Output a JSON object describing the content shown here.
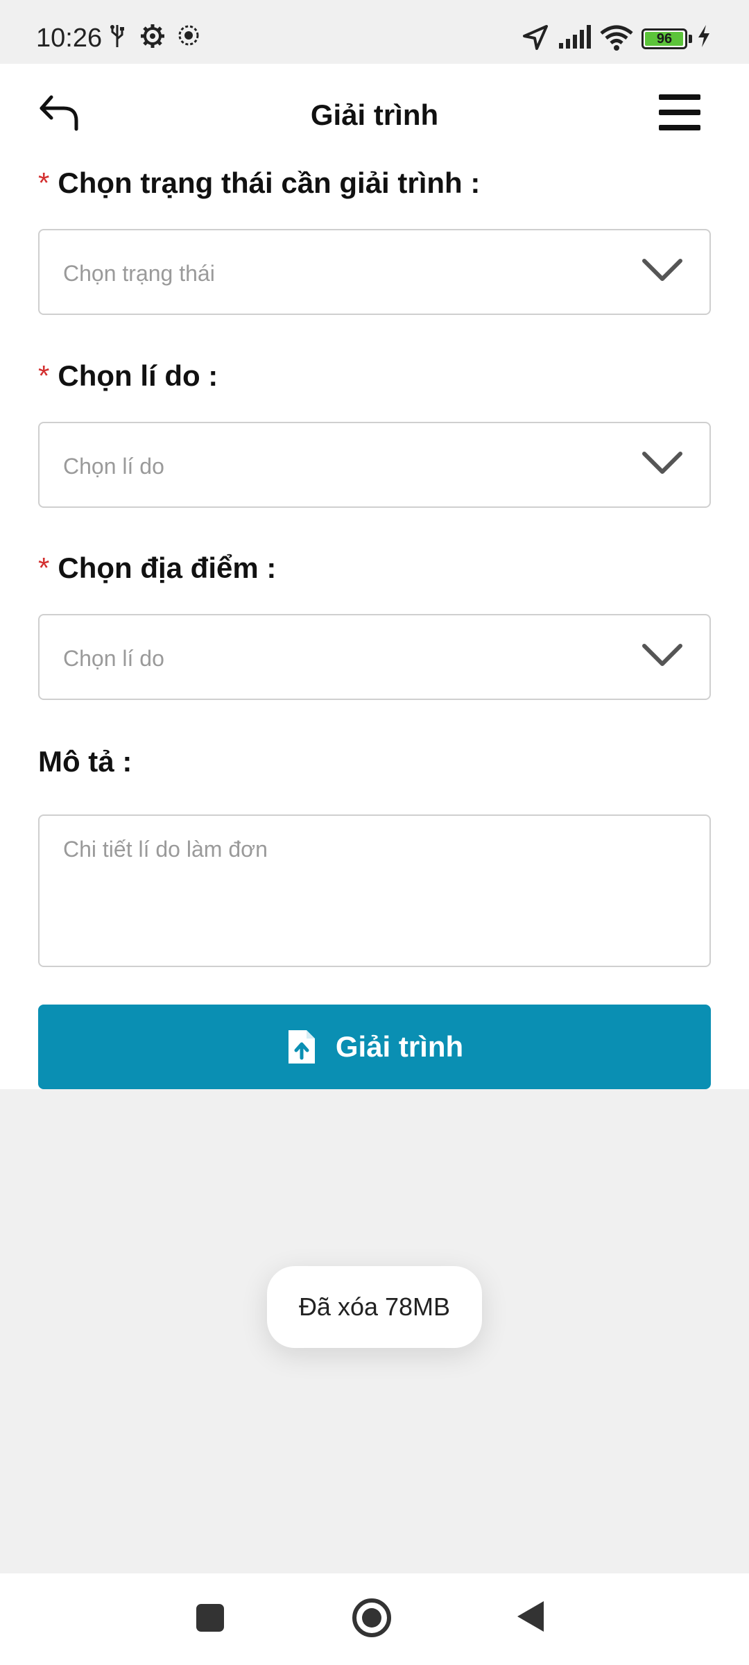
{
  "status_bar": {
    "time": "10:26",
    "battery_level": "96",
    "icons": [
      "usb-icon",
      "settings-gear-icon",
      "app-notification-icon",
      "location-arrow-icon",
      "signal-icon",
      "wifi-icon",
      "battery-icon",
      "charging-bolt-icon"
    ]
  },
  "header": {
    "title": "Giải trình",
    "back_icon": "undo-back-arrow-icon",
    "menu_icon": "hamburger-menu-icon"
  },
  "form": {
    "status_field": {
      "required_mark": "*",
      "label": "Chọn trạng thái cần giải trình :",
      "placeholder": "Chọn trạng thái"
    },
    "reason_field": {
      "required_mark": "*",
      "label": "Chọn lí do :",
      "placeholder": "Chọn lí do"
    },
    "location_field": {
      "required_mark": "*",
      "label": "Chọn địa điểm :",
      "placeholder": "Chọn lí do"
    },
    "description_field": {
      "label": "Mô tả :",
      "placeholder": "Chi tiết lí do làm đơn"
    },
    "submit_button": {
      "label": "Giải trình",
      "icon": "file-upload-icon"
    }
  },
  "toast": {
    "message": "Đã xóa 78MB"
  },
  "nav_bar": {
    "buttons": [
      "recent-apps-button",
      "home-button",
      "back-button"
    ]
  },
  "colors": {
    "accent": "#0a8fb3",
    "required": "#d32f2f",
    "battery": "#5cc43a"
  }
}
